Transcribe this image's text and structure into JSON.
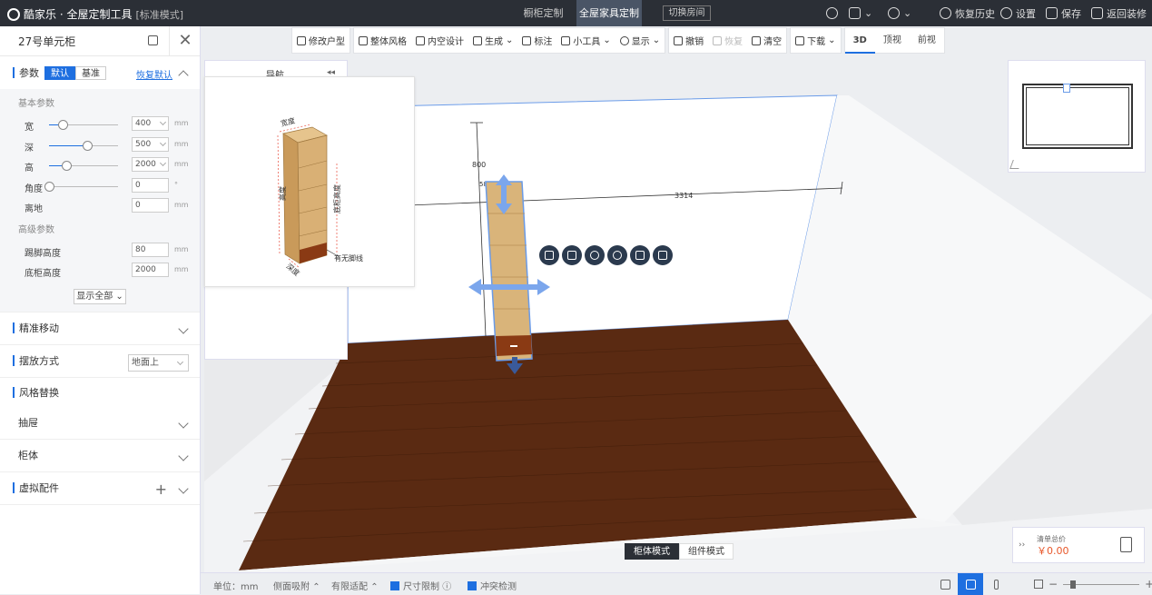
{
  "topbar": {
    "logo": "酷家乐 · 全屋定制工具",
    "mode": "[标准模式]",
    "tabs": [
      {
        "label": "橱柜定制",
        "active": false
      },
      {
        "label": "全屋家具定制",
        "active": true
      }
    ],
    "switch_room": "切换房间",
    "right": {
      "history": "恢复历史",
      "settings": "设置",
      "save": "保存",
      "back": "返回装修"
    }
  },
  "left_panel": {
    "title": "27号单元柜",
    "params_section": {
      "label": "参数",
      "seg_default": "默认",
      "seg_base": "基准",
      "reset": "恢复默认",
      "basic_label": "基本参数",
      "basic": [
        {
          "label": "宽",
          "value": "400",
          "unit": "mm",
          "level": 0.2
        },
        {
          "label": "深",
          "value": "500",
          "unit": "mm",
          "level": 0.55
        },
        {
          "label": "高",
          "value": "2000",
          "unit": "mm",
          "level": 0.25
        },
        {
          "label": "角度",
          "value": "0",
          "unit": "°",
          "level": 0.0
        },
        {
          "label": "离地",
          "value": "0",
          "unit": "mm"
        }
      ],
      "advanced_label": "高级参数",
      "advanced": [
        {
          "label": "踢脚高度",
          "value": "80",
          "unit": "mm"
        },
        {
          "label": "底柜高度",
          "value": "2000",
          "unit": "mm"
        }
      ],
      "show_all": "显示全部"
    },
    "precise_move": "精准移动",
    "placement": {
      "label": "摆放方式",
      "value": "地面上"
    },
    "style_replace": "风格替换",
    "drawer": "抽屉",
    "cabinet": "柜体",
    "virtual_parts": "虚拟配件"
  },
  "toolbar": {
    "group1": [
      "修改户型",
      "整体风格",
      "内空设计",
      "生成",
      "标注",
      "小工具",
      "显示"
    ],
    "undo": "撤销",
    "redo": "恢复",
    "clear": "清空",
    "download": "下载",
    "views": [
      {
        "label": "3D",
        "active": true
      },
      {
        "label": "顶视",
        "active": false
      },
      {
        "label": "前视",
        "active": false
      }
    ]
  },
  "nav_panel": {
    "title": "导航",
    "collapse": "◂◂"
  },
  "preview": {
    "labels": [
      "宽度",
      "高度",
      "深度",
      "底柜高度",
      "有无脚线"
    ]
  },
  "scene": {
    "dim_800": "800",
    "dim_3314": "3314",
    "dim_short": "58",
    "colors": {
      "floor": "#5a2a12",
      "wall": "#ffffff",
      "accent": "#1e6fe0"
    }
  },
  "quote": {
    "label": "清单总价",
    "value": "￥0.00"
  },
  "mode_switch": [
    {
      "label": "柜体模式",
      "active": true
    },
    {
      "label": "组件模式",
      "active": false
    }
  ],
  "bottombar": {
    "unit": "单位：mm",
    "side_snap": "侧面吸附",
    "limited_fit": "有限适配",
    "size_limit": "尺寸限制",
    "collision": "冲突检测"
  }
}
